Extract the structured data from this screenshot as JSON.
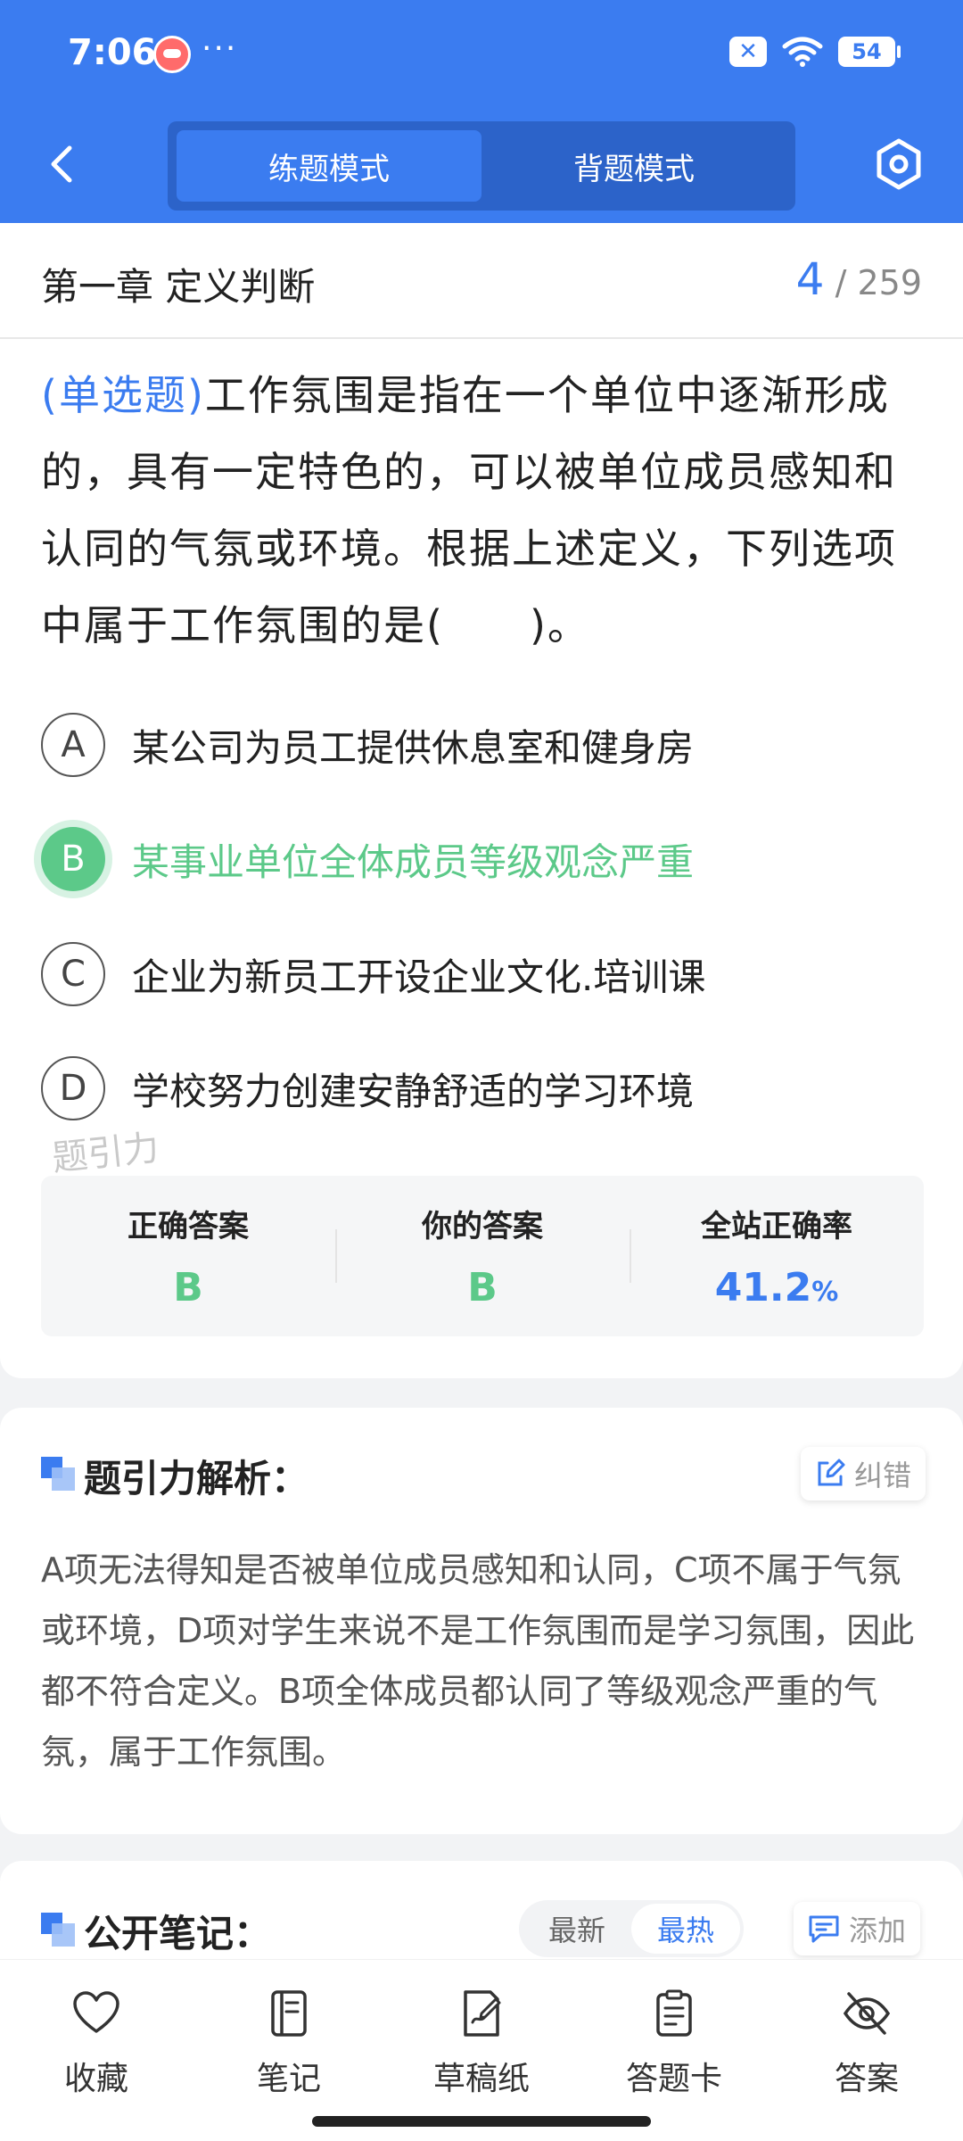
{
  "status_bar": {
    "time": "7:06",
    "dots": "···",
    "sim_label": "✕",
    "battery": "54"
  },
  "nav": {
    "tabs": [
      {
        "label": "练题模式",
        "active": true
      },
      {
        "label": "背题模式",
        "active": false
      }
    ]
  },
  "chapter": {
    "title": "第一章 定义判断",
    "current": "4",
    "separator": "/",
    "total": "259"
  },
  "question": {
    "type": "(单选题)",
    "text": "工作氛围是指在一个单位中逐渐形成的，具有一定特色的，可以被单位成员感知和认同的气氛或环境。根据上述定义，下列选项中属于工作氛围的是(　　)。",
    "options": [
      {
        "letter": "A",
        "text": "某公司为员工提供休息室和健身房"
      },
      {
        "letter": "B",
        "text": "某事业单位全体成员等级观念严重"
      },
      {
        "letter": "C",
        "text": "企业为新员工开设企业文化.培训课"
      },
      {
        "letter": "D",
        "text": "学校努力创建安静舒适的学习环境"
      }
    ],
    "watermark": "题引力"
  },
  "answer_summary": {
    "correct_label": "正确答案",
    "correct_value": "B",
    "yours_label": "你的答案",
    "yours_value": "B",
    "rate_label": "全站正确率",
    "rate_value": "41.2",
    "rate_unit": "%"
  },
  "analysis": {
    "title": "题引力解析：",
    "correction_label": "纠错",
    "text": "A项无法得知是否被单位成员感知和认同，C项不属于气氛或环境，D项对学生来说不是工作氛围而是学习氛围，因此都不符合定义。B项全体成员都认同了等级观念严重的气氛，属于工作氛围。"
  },
  "notes": {
    "title": "公开笔记：",
    "sort_options": [
      "最新",
      "最热"
    ],
    "add_label": "添加"
  },
  "bottom_bar": {
    "items": [
      {
        "label": "收藏",
        "icon": "heart-icon"
      },
      {
        "label": "笔记",
        "icon": "notebook-icon"
      },
      {
        "label": "草稿纸",
        "icon": "draft-paper-icon"
      },
      {
        "label": "答题卡",
        "icon": "answer-card-icon"
      },
      {
        "label": "答案",
        "icon": "eye-off-icon"
      }
    ]
  },
  "colors": {
    "primary": "#3b7cf0",
    "correct": "#5cc989",
    "text": "#222222"
  }
}
